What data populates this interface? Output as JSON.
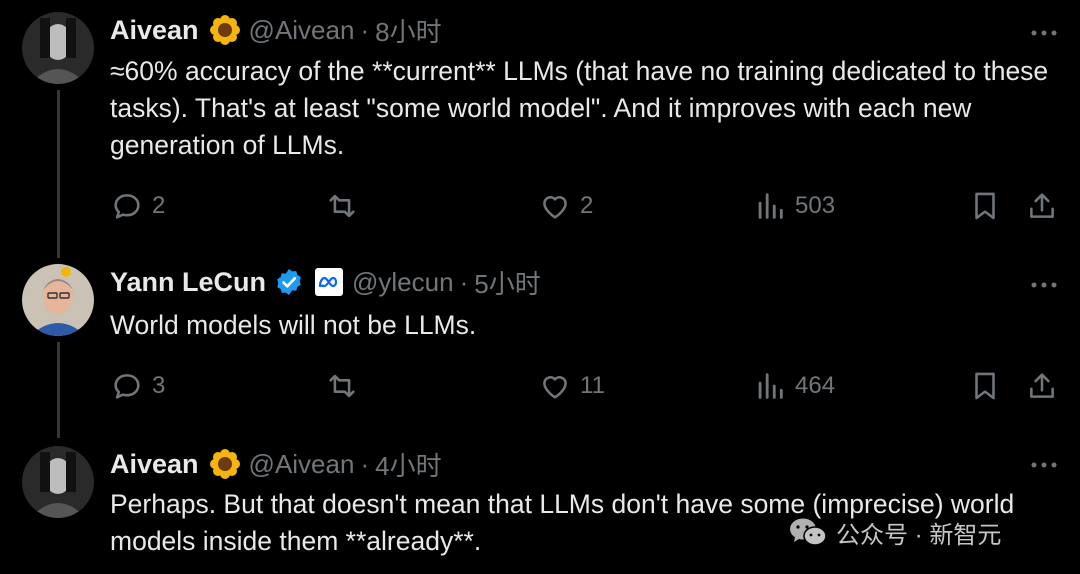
{
  "tweets": [
    {
      "name": "Aivean",
      "emoji": "sunflower-emoji",
      "handle": "@Aivean",
      "time": "8小时",
      "text": "≈60% accuracy of the **current** LLMs (that have no training dedicated to these tasks). That's at least \"some world model\". And it improves with each new generation of LLMs.",
      "replies": "2",
      "reposts": "",
      "likes": "2",
      "views": "503"
    },
    {
      "name": "Yann LeCun",
      "badge": "verified-badge-icon",
      "org": "meta-logo-icon",
      "handle": "@ylecun",
      "time": "5小时",
      "text": "World models will not be LLMs.",
      "replies": "3",
      "reposts": "",
      "likes": "11",
      "views": "464"
    },
    {
      "name": "Aivean",
      "emoji": "sunflower-emoji",
      "handle": "@Aivean",
      "time": "4小时",
      "text": "Perhaps. But that doesn't mean that LLMs don't have some (imprecise) world models inside them **already**."
    }
  ],
  "separator": "·",
  "watermark": "公众号 · 新智元",
  "colors": {
    "background": "#000000",
    "text": "#e7e9ea",
    "muted": "#71767b",
    "verified": "#1d9bf0",
    "sunflower": "#f6b40e"
  }
}
